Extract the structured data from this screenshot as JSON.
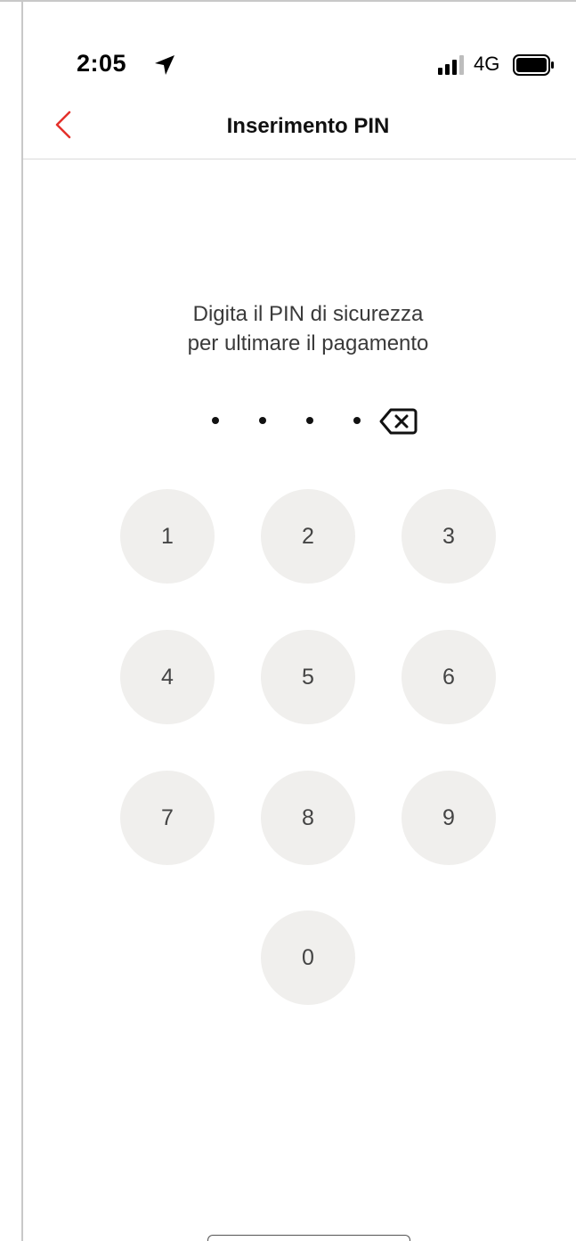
{
  "status_bar": {
    "time": "2:05",
    "network": "4G",
    "icons": [
      "location-arrow-icon",
      "signal-bars-icon",
      "battery-icon"
    ]
  },
  "nav": {
    "title": "Inserimento PIN",
    "back_icon": "chevron-left-icon",
    "accent_color": "#e4312b"
  },
  "prompt": {
    "line1": "Digita il PIN di sicurezza",
    "line2": "per ultimare il pagamento"
  },
  "pin": {
    "entered_digits": 4,
    "delete_icon": "backspace-icon"
  },
  "keypad": {
    "keys": [
      "1",
      "2",
      "3",
      "4",
      "5",
      "6",
      "7",
      "8",
      "9",
      "0"
    ],
    "key_background": "#f0efed"
  }
}
